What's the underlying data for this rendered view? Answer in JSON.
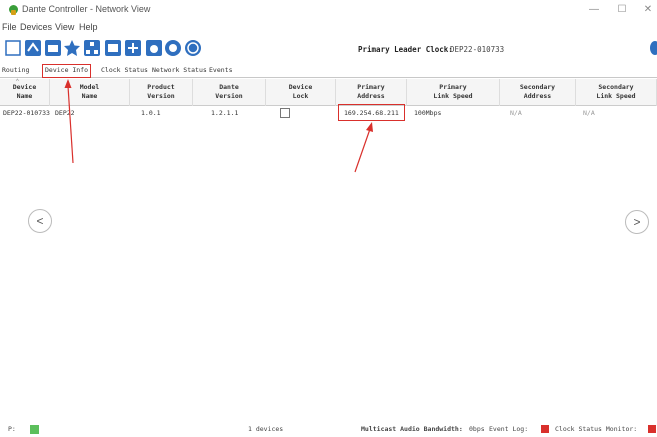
{
  "window": {
    "title": "Dante Controller - Network View",
    "minimize": "—",
    "maximize": "☐",
    "close": "✕"
  },
  "menu": {
    "items": [
      "File",
      "Devices",
      "View",
      "Help"
    ]
  },
  "toolbar": {
    "buttons": [
      "rescan-icon",
      "routing-icon",
      "folder-icon",
      "star-icon",
      "network-icon",
      "device-view-icon",
      "add-icon",
      "event-icon",
      "status-icon",
      "help-icon"
    ],
    "leader_label": "Primary Leader Clock:",
    "leader_value": "DEP22-010733"
  },
  "tabs": {
    "items": [
      "Routing",
      "Device Info",
      "Clock Status",
      "Network Status",
      "Events"
    ],
    "active": "Device Info"
  },
  "table": {
    "columns": [
      "Device\nName",
      "Model\nName",
      "Product\nVersion",
      "Dante\nVersion",
      "Device\nLock",
      "Primary\nAddress",
      "Primary\nLink Speed",
      "Secondary\nAddress",
      "Secondary\nLink Speed"
    ],
    "rows": [
      {
        "device_name": "DEP22-010733",
        "model_name": "DEP22",
        "product_version": "1.0.1",
        "dante_version": "1.2.1.1",
        "device_lock": false,
        "primary_address": "169.254.68.211",
        "primary_link_speed": "100Mbps",
        "secondary_address": "N/A",
        "secondary_link_speed": "N/A"
      }
    ]
  },
  "nav": {
    "prev": "<",
    "next": ">"
  },
  "statusbar": {
    "p_label": "P:",
    "device_count": "1 devices",
    "bandwidth_label": "Multicast Audio Bandwidth:",
    "bandwidth_value": "0bps",
    "event_log": "Event Log:",
    "clock_monitor": "Clock Status Monitor:"
  },
  "colors": {
    "highlight": "#d9302c",
    "status_ok": "#5cbf5c"
  }
}
